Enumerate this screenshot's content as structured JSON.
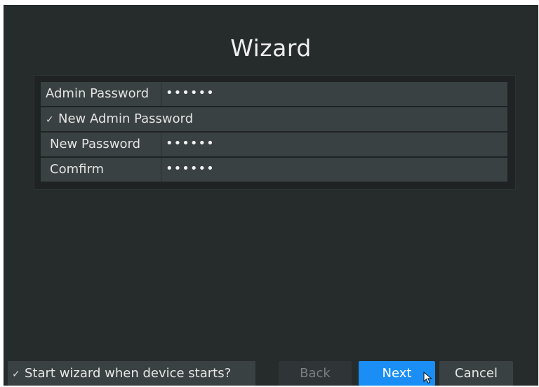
{
  "window": {
    "title": "Wizard"
  },
  "form": {
    "admin_password": {
      "label": "Admin Password",
      "value": "••••••"
    },
    "new_admin_password": {
      "label": "New Admin Password",
      "checked": true
    },
    "new_password": {
      "label": "New Password",
      "value": "••••••"
    },
    "confirm": {
      "label": "Comfirm",
      "value": "••••••"
    }
  },
  "footer": {
    "start_wizard": {
      "label": "Start wizard when device starts?",
      "checked": true
    },
    "back_label": "Back",
    "next_label": "Next",
    "cancel_label": "Cancel"
  },
  "icons": {
    "checkbox": "check-icon",
    "pointer": "cursor-icon"
  },
  "colors": {
    "background": "#262b2c",
    "panel": "#1f2323",
    "row": "#3a4142",
    "accent": "#1a8ef4",
    "text": "#e3e3e3",
    "disabled_text": "#7a7f80"
  }
}
